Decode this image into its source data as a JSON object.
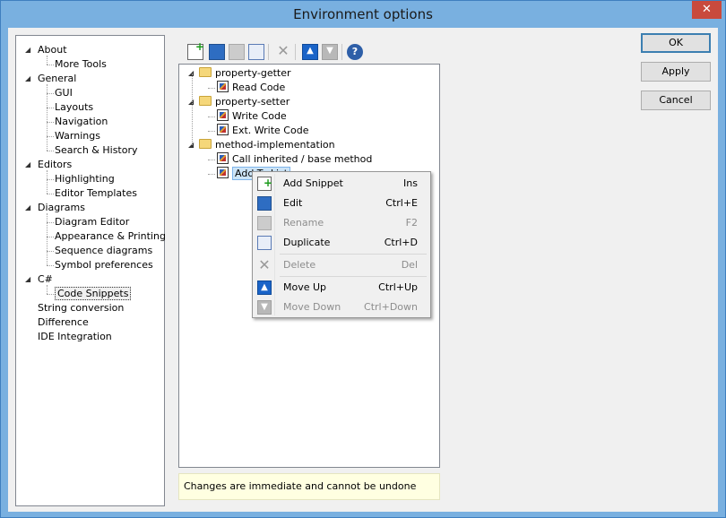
{
  "window": {
    "title": "Environment options",
    "close_glyph": "✕"
  },
  "nav_tree": [
    {
      "label": "About",
      "level": 0,
      "expanded": true
    },
    {
      "label": "More Tools",
      "level": 1
    },
    {
      "label": "General",
      "level": 0,
      "expanded": true
    },
    {
      "label": "GUI",
      "level": 1
    },
    {
      "label": "Layouts",
      "level": 1
    },
    {
      "label": "Navigation",
      "level": 1
    },
    {
      "label": "Warnings",
      "level": 1
    },
    {
      "label": "Search & History",
      "level": 1
    },
    {
      "label": "Editors",
      "level": 0,
      "expanded": true
    },
    {
      "label": "Highlighting",
      "level": 1
    },
    {
      "label": "Editor Templates",
      "level": 1
    },
    {
      "label": "Diagrams",
      "level": 0,
      "expanded": true
    },
    {
      "label": "Diagram Editor",
      "level": 1
    },
    {
      "label": "Appearance & Printing",
      "level": 1
    },
    {
      "label": "Sequence diagrams",
      "level": 1
    },
    {
      "label": "Symbol preferences",
      "level": 1
    },
    {
      "label": "C#",
      "level": 0,
      "expanded": true
    },
    {
      "label": "Code Snippets",
      "level": 1,
      "selected": true
    },
    {
      "label": "String conversion",
      "level": 0
    },
    {
      "label": "Difference",
      "level": 0
    },
    {
      "label": "IDE Integration",
      "level": 0
    }
  ],
  "toolbar": {
    "icons": [
      "add-snippet-icon",
      "edit-icon",
      "rename-icon",
      "duplicate-icon",
      "delete-icon",
      "move-up-icon",
      "move-down-icon",
      "help-icon"
    ],
    "help_glyph": "?"
  },
  "snippet_tree": [
    {
      "label": "property-getter",
      "type": "folder",
      "level": 0
    },
    {
      "label": "Read Code",
      "type": "snippet",
      "level": 1
    },
    {
      "label": "property-setter",
      "type": "folder",
      "level": 0
    },
    {
      "label": "Write Code",
      "type": "snippet",
      "level": 1
    },
    {
      "label": "Ext. Write Code",
      "type": "snippet",
      "level": 1
    },
    {
      "label": "method-implementation",
      "type": "folder",
      "level": 0
    },
    {
      "label": "Call inherited / base method",
      "type": "snippet",
      "level": 1
    },
    {
      "label": "Add To List",
      "type": "snippet",
      "level": 1,
      "selected": true
    }
  ],
  "context_menu": [
    {
      "label": "Add Snippet",
      "shortcut": "Ins",
      "enabled": true,
      "icon": "add-snippet-icon"
    },
    {
      "label": "Edit",
      "shortcut": "Ctrl+E",
      "enabled": true,
      "icon": "edit-icon"
    },
    {
      "label": "Rename",
      "shortcut": "F2",
      "enabled": false,
      "icon": "rename-icon"
    },
    {
      "label": "Duplicate",
      "shortcut": "Ctrl+D",
      "enabled": true,
      "icon": "duplicate-icon"
    },
    {
      "separator": true
    },
    {
      "label": "Delete",
      "shortcut": "Del",
      "enabled": false,
      "icon": "delete-icon"
    },
    {
      "separator": true
    },
    {
      "label": "Move Up",
      "shortcut": "Ctrl+Up",
      "enabled": true,
      "icon": "move-up-icon"
    },
    {
      "label": "Move Down",
      "shortcut": "Ctrl+Down",
      "enabled": false,
      "icon": "move-down-icon"
    }
  ],
  "status_note": "Changes are immediate and cannot be undone",
  "buttons": {
    "ok": "OK",
    "apply": "Apply",
    "cancel": "Cancel"
  },
  "colors": {
    "titlebar": "#79b0e0",
    "close": "#c94a3d",
    "note_bg": "#ffffe1",
    "selection": "#cce4f7"
  }
}
